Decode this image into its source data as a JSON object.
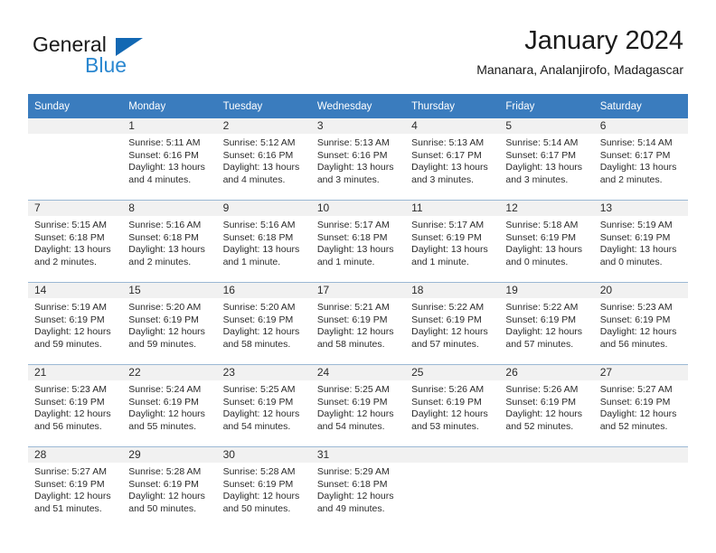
{
  "brand": {
    "word_one": "General",
    "word_two": "Blue",
    "triangle_color": "#1268b3",
    "blue_color": "#2a87d0"
  },
  "header": {
    "month_title": "January 2024",
    "location": "Mananara, Analanjirofo, Madagascar"
  },
  "theme": {
    "header_row_bg": "#3a7cbe",
    "header_row_text": "#ffffff",
    "daynum_bg": "#f1f1f1",
    "grid_line": "#9bb8d4",
    "body_text": "#2b2b2b"
  },
  "calendar": {
    "weekday_headers": [
      "Sunday",
      "Monday",
      "Tuesday",
      "Wednesday",
      "Thursday",
      "Friday",
      "Saturday"
    ],
    "weeks": [
      [
        {
          "day": "",
          "sunrise": "",
          "sunset": "",
          "daylight": ""
        },
        {
          "day": "1",
          "sunrise": "Sunrise: 5:11 AM",
          "sunset": "Sunset: 6:16 PM",
          "daylight": "Daylight: 13 hours and 4 minutes."
        },
        {
          "day": "2",
          "sunrise": "Sunrise: 5:12 AM",
          "sunset": "Sunset: 6:16 PM",
          "daylight": "Daylight: 13 hours and 4 minutes."
        },
        {
          "day": "3",
          "sunrise": "Sunrise: 5:13 AM",
          "sunset": "Sunset: 6:16 PM",
          "daylight": "Daylight: 13 hours and 3 minutes."
        },
        {
          "day": "4",
          "sunrise": "Sunrise: 5:13 AM",
          "sunset": "Sunset: 6:17 PM",
          "daylight": "Daylight: 13 hours and 3 minutes."
        },
        {
          "day": "5",
          "sunrise": "Sunrise: 5:14 AM",
          "sunset": "Sunset: 6:17 PM",
          "daylight": "Daylight: 13 hours and 3 minutes."
        },
        {
          "day": "6",
          "sunrise": "Sunrise: 5:14 AM",
          "sunset": "Sunset: 6:17 PM",
          "daylight": "Daylight: 13 hours and 2 minutes."
        }
      ],
      [
        {
          "day": "7",
          "sunrise": "Sunrise: 5:15 AM",
          "sunset": "Sunset: 6:18 PM",
          "daylight": "Daylight: 13 hours and 2 minutes."
        },
        {
          "day": "8",
          "sunrise": "Sunrise: 5:16 AM",
          "sunset": "Sunset: 6:18 PM",
          "daylight": "Daylight: 13 hours and 2 minutes."
        },
        {
          "day": "9",
          "sunrise": "Sunrise: 5:16 AM",
          "sunset": "Sunset: 6:18 PM",
          "daylight": "Daylight: 13 hours and 1 minute."
        },
        {
          "day": "10",
          "sunrise": "Sunrise: 5:17 AM",
          "sunset": "Sunset: 6:18 PM",
          "daylight": "Daylight: 13 hours and 1 minute."
        },
        {
          "day": "11",
          "sunrise": "Sunrise: 5:17 AM",
          "sunset": "Sunset: 6:19 PM",
          "daylight": "Daylight: 13 hours and 1 minute."
        },
        {
          "day": "12",
          "sunrise": "Sunrise: 5:18 AM",
          "sunset": "Sunset: 6:19 PM",
          "daylight": "Daylight: 13 hours and 0 minutes."
        },
        {
          "day": "13",
          "sunrise": "Sunrise: 5:19 AM",
          "sunset": "Sunset: 6:19 PM",
          "daylight": "Daylight: 13 hours and 0 minutes."
        }
      ],
      [
        {
          "day": "14",
          "sunrise": "Sunrise: 5:19 AM",
          "sunset": "Sunset: 6:19 PM",
          "daylight": "Daylight: 12 hours and 59 minutes."
        },
        {
          "day": "15",
          "sunrise": "Sunrise: 5:20 AM",
          "sunset": "Sunset: 6:19 PM",
          "daylight": "Daylight: 12 hours and 59 minutes."
        },
        {
          "day": "16",
          "sunrise": "Sunrise: 5:20 AM",
          "sunset": "Sunset: 6:19 PM",
          "daylight": "Daylight: 12 hours and 58 minutes."
        },
        {
          "day": "17",
          "sunrise": "Sunrise: 5:21 AM",
          "sunset": "Sunset: 6:19 PM",
          "daylight": "Daylight: 12 hours and 58 minutes."
        },
        {
          "day": "18",
          "sunrise": "Sunrise: 5:22 AM",
          "sunset": "Sunset: 6:19 PM",
          "daylight": "Daylight: 12 hours and 57 minutes."
        },
        {
          "day": "19",
          "sunrise": "Sunrise: 5:22 AM",
          "sunset": "Sunset: 6:19 PM",
          "daylight": "Daylight: 12 hours and 57 minutes."
        },
        {
          "day": "20",
          "sunrise": "Sunrise: 5:23 AM",
          "sunset": "Sunset: 6:19 PM",
          "daylight": "Daylight: 12 hours and 56 minutes."
        }
      ],
      [
        {
          "day": "21",
          "sunrise": "Sunrise: 5:23 AM",
          "sunset": "Sunset: 6:19 PM",
          "daylight": "Daylight: 12 hours and 56 minutes."
        },
        {
          "day": "22",
          "sunrise": "Sunrise: 5:24 AM",
          "sunset": "Sunset: 6:19 PM",
          "daylight": "Daylight: 12 hours and 55 minutes."
        },
        {
          "day": "23",
          "sunrise": "Sunrise: 5:25 AM",
          "sunset": "Sunset: 6:19 PM",
          "daylight": "Daylight: 12 hours and 54 minutes."
        },
        {
          "day": "24",
          "sunrise": "Sunrise: 5:25 AM",
          "sunset": "Sunset: 6:19 PM",
          "daylight": "Daylight: 12 hours and 54 minutes."
        },
        {
          "day": "25",
          "sunrise": "Sunrise: 5:26 AM",
          "sunset": "Sunset: 6:19 PM",
          "daylight": "Daylight: 12 hours and 53 minutes."
        },
        {
          "day": "26",
          "sunrise": "Sunrise: 5:26 AM",
          "sunset": "Sunset: 6:19 PM",
          "daylight": "Daylight: 12 hours and 52 minutes."
        },
        {
          "day": "27",
          "sunrise": "Sunrise: 5:27 AM",
          "sunset": "Sunset: 6:19 PM",
          "daylight": "Daylight: 12 hours and 52 minutes."
        }
      ],
      [
        {
          "day": "28",
          "sunrise": "Sunrise: 5:27 AM",
          "sunset": "Sunset: 6:19 PM",
          "daylight": "Daylight: 12 hours and 51 minutes."
        },
        {
          "day": "29",
          "sunrise": "Sunrise: 5:28 AM",
          "sunset": "Sunset: 6:19 PM",
          "daylight": "Daylight: 12 hours and 50 minutes."
        },
        {
          "day": "30",
          "sunrise": "Sunrise: 5:28 AM",
          "sunset": "Sunset: 6:19 PM",
          "daylight": "Daylight: 12 hours and 50 minutes."
        },
        {
          "day": "31",
          "sunrise": "Sunrise: 5:29 AM",
          "sunset": "Sunset: 6:18 PM",
          "daylight": "Daylight: 12 hours and 49 minutes."
        },
        {
          "day": "",
          "sunrise": "",
          "sunset": "",
          "daylight": ""
        },
        {
          "day": "",
          "sunrise": "",
          "sunset": "",
          "daylight": ""
        },
        {
          "day": "",
          "sunrise": "",
          "sunset": "",
          "daylight": ""
        }
      ]
    ]
  }
}
